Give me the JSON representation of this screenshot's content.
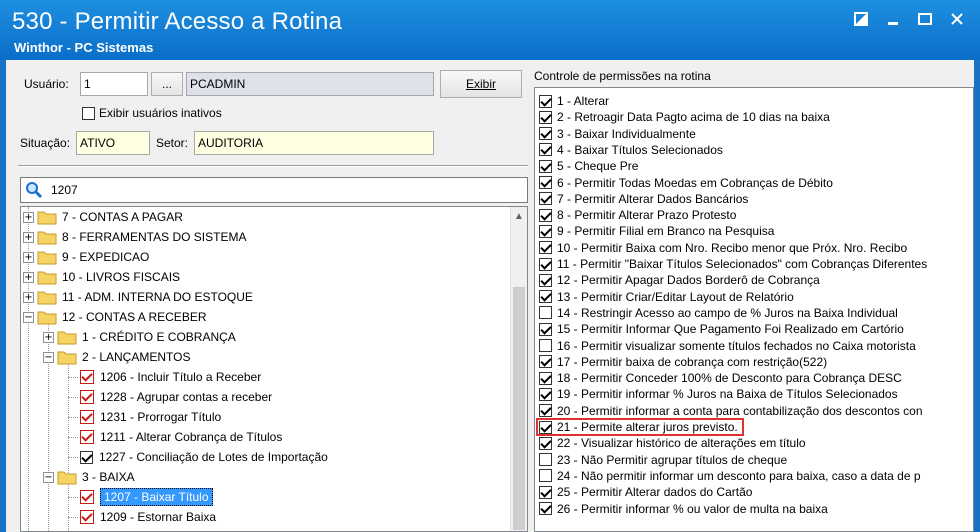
{
  "window": {
    "title": "530 - Permitir Acesso a Rotina",
    "subtitle": "Winthor - PC Sistemas"
  },
  "form": {
    "usuario_label": "Usuário:",
    "usuario_code": "1",
    "lookup_label": "...",
    "usuario_name": "PCADMIN",
    "exibir_label": "Exibir",
    "inativos_label": "Exibir usuários inativos",
    "situacao_label": "Situação:",
    "situacao_value": "ATIVO",
    "setor_label": "Setor:",
    "setor_value": "AUDITORIA"
  },
  "search": {
    "value": "1207",
    "icon": "search-icon"
  },
  "tree": {
    "nodes": [
      "7 - CONTAS A PAGAR",
      "8 - FERRAMENTAS DO SISTEMA",
      "9 - EXPEDICAO",
      "10 - LIVROS FISCAIS",
      "11 - ADM. INTERNA DO ESTOQUE",
      "12 - CONTAS A RECEBER",
      "1 - CRÉDITO E COBRANÇA",
      "2 - LANÇAMENTOS",
      "1206 - Incluir Título a Receber",
      "1228 - Agrupar contas a receber",
      "1231 - Prorrogar Título",
      "1211 - Alterar Cobrança de Títulos",
      "1227 - Conciliação de Lotes de Importação",
      "3 - BAIXA",
      "1207 - Baixar Título",
      "1209 - Estornar Baixa"
    ]
  },
  "permissions": {
    "title": "Controle de permissões na rotina",
    "items": [
      {
        "label": "1 - Alterar",
        "checked": true
      },
      {
        "label": "2 - Retroagir Data Pagto acima de 10 dias na baixa",
        "checked": true
      },
      {
        "label": "3 - Baixar Individualmente",
        "checked": true
      },
      {
        "label": "4 - Baixar Títulos Selecionados",
        "checked": true
      },
      {
        "label": "5 - Cheque Pre",
        "checked": true
      },
      {
        "label": "6 - Permitir Todas Moedas em Cobranças de Débito",
        "checked": true
      },
      {
        "label": "7 - Permitir Alterar Dados Bancários",
        "checked": true
      },
      {
        "label": "8 - Permitir Alterar Prazo Protesto",
        "checked": true
      },
      {
        "label": "9 - Permitir Filial em Branco na Pesquisa",
        "checked": true
      },
      {
        "label": "10 - Permitir Baixa com Nro. Recibo menor que Próx. Nro. Recibo",
        "checked": true
      },
      {
        "label": "11 - Permitir \"Baixar Títulos Selecionados\" com Cobranças Diferentes",
        "checked": true
      },
      {
        "label": "12 - Permitir Apagar Dados Borderô de Cobrança",
        "checked": true
      },
      {
        "label": "13 - Permitir Criar/Editar Layout de Relatório",
        "checked": true
      },
      {
        "label": "14 - Restringir Acesso ao campo de % Juros na Baixa Individual",
        "checked": false
      },
      {
        "label": "15 - Permitir Informar Que Pagamento Foi Realizado em Cartório",
        "checked": true
      },
      {
        "label": "16 - Permitir visualizar somente títulos fechados no Caixa motorista",
        "checked": false
      },
      {
        "label": "17 - Permitir baixa de cobrança com restrição(522)",
        "checked": true
      },
      {
        "label": "18 - Permitir Conceder 100% de Desconto para Cobrança DESC",
        "checked": true
      },
      {
        "label": "19 - Permitir informar % Juros na Baixa de Títulos Selecionados",
        "checked": true
      },
      {
        "label": "20 - Permitir informar a conta para contabilização dos descontos con",
        "checked": true
      },
      {
        "label": "21 - Permite alterar juros previsto.",
        "checked": true
      },
      {
        "label": "22 - Visualizar histórico de alterações em título",
        "checked": true
      },
      {
        "label": "23 - Não Permitir agrupar títulos de cheque",
        "checked": false
      },
      {
        "label": "24 - Não permitir informar um desconto para baixa, caso a data de p",
        "checked": false
      },
      {
        "label": "25 - Permitir Alterar dados do Cartão",
        "checked": true
      },
      {
        "label": "26 - Permitir informar % ou valor de multa na baixa",
        "checked": true
      }
    ]
  },
  "colors": {
    "titlebar": "#0a6ec8",
    "highlight": "#e03030",
    "selection": "#3399ff"
  }
}
